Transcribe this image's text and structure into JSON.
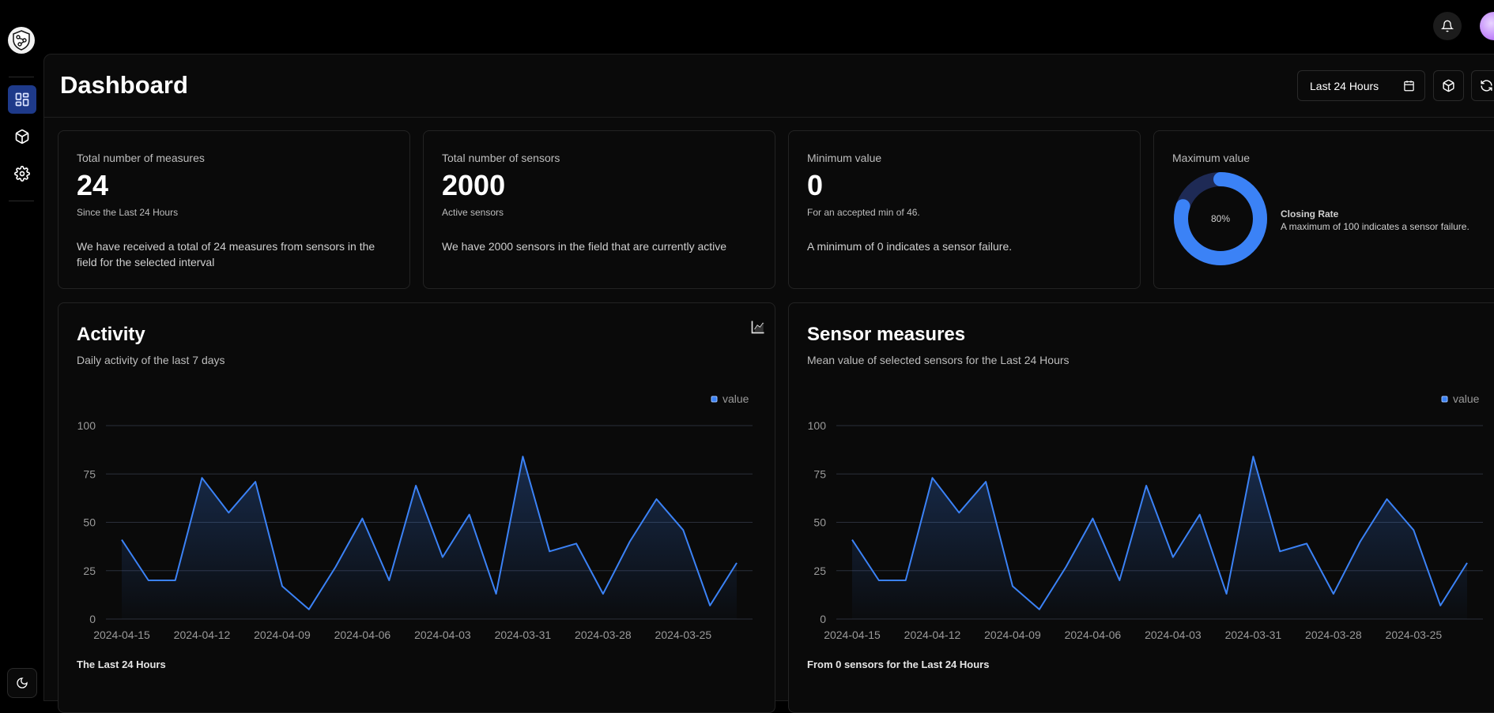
{
  "header": {
    "page_title": "Dashboard",
    "date_range_label": "Last 24 Hours"
  },
  "icons": {
    "logo": "shield-network-icon",
    "bell": "bell-icon",
    "avatar": "user-avatar",
    "calendar": "calendar-icon",
    "box": "cube-icon",
    "refresh": "refresh-icon",
    "sidebar": [
      "dashboard-icon",
      "cube-icon",
      "gear-icon"
    ],
    "theme": "moon-icon",
    "chart_toggle": "area-chart-icon"
  },
  "colors": {
    "accent": "#3b82f6",
    "active_nav": "#1e3a8a",
    "donut_track": "#1e2a55"
  },
  "stats": [
    {
      "label": "Total number of measures",
      "value": "24",
      "sub": "Since the Last 24 Hours",
      "desc": "We have received a total of 24 measures from sensors in the field for the selected interval"
    },
    {
      "label": "Total number of sensors",
      "value": "2000",
      "sub": "Active sensors",
      "desc": "We have 2000 sensors in the field that are currently active"
    },
    {
      "label": "Minimum value",
      "value": "0",
      "sub": "For an accepted min of 46.",
      "desc": "A minimum of 0 indicates a sensor failure."
    }
  ],
  "max_card": {
    "label": "Maximum value",
    "percent_label": "80%",
    "rate_title": "Closing Rate",
    "rate_desc": "A maximum of 100 indicates a sensor failure."
  },
  "charts": [
    {
      "title": "Activity",
      "subtitle": "Daily activity of the last 7 days",
      "legend": "value",
      "footer": "The Last 24 Hours"
    },
    {
      "title": "Sensor measures",
      "subtitle": "Mean value of selected sensors for the Last 24 Hours",
      "legend": "value",
      "footer": "From 0 sensors for the Last 24 Hours"
    }
  ],
  "chart_data": [
    {
      "type": "area",
      "title": "Activity",
      "ylim": [
        0,
        100
      ],
      "yticks": [
        0,
        25,
        50,
        75,
        100
      ],
      "xtick_labels": [
        "2024-04-15",
        "2024-04-12",
        "2024-04-09",
        "2024-04-06",
        "2024-04-03",
        "2024-03-31",
        "2024-03-28",
        "2024-03-25"
      ],
      "series": [
        {
          "name": "value",
          "values": [
            41,
            20,
            20,
            73,
            55,
            71,
            17,
            5,
            27,
            52,
            20,
            69,
            32,
            54,
            13,
            84,
            35,
            39,
            13,
            40,
            62,
            46,
            7,
            29
          ]
        }
      ],
      "grid": true,
      "legend": "top-right"
    },
    {
      "type": "area",
      "title": "Sensor measures",
      "ylim": [
        0,
        100
      ],
      "yticks": [
        0,
        25,
        50,
        75,
        100
      ],
      "xtick_labels": [
        "2024-04-15",
        "2024-04-12",
        "2024-04-09",
        "2024-04-06",
        "2024-04-03",
        "2024-03-31",
        "2024-03-28",
        "2024-03-25"
      ],
      "series": [
        {
          "name": "value",
          "values": [
            41,
            20,
            20,
            73,
            55,
            71,
            17,
            5,
            27,
            52,
            20,
            69,
            32,
            54,
            13,
            84,
            35,
            39,
            13,
            40,
            62,
            46,
            7,
            29
          ]
        }
      ],
      "grid": true,
      "legend": "top-right"
    }
  ],
  "donut": {
    "fraction": 0.8
  }
}
